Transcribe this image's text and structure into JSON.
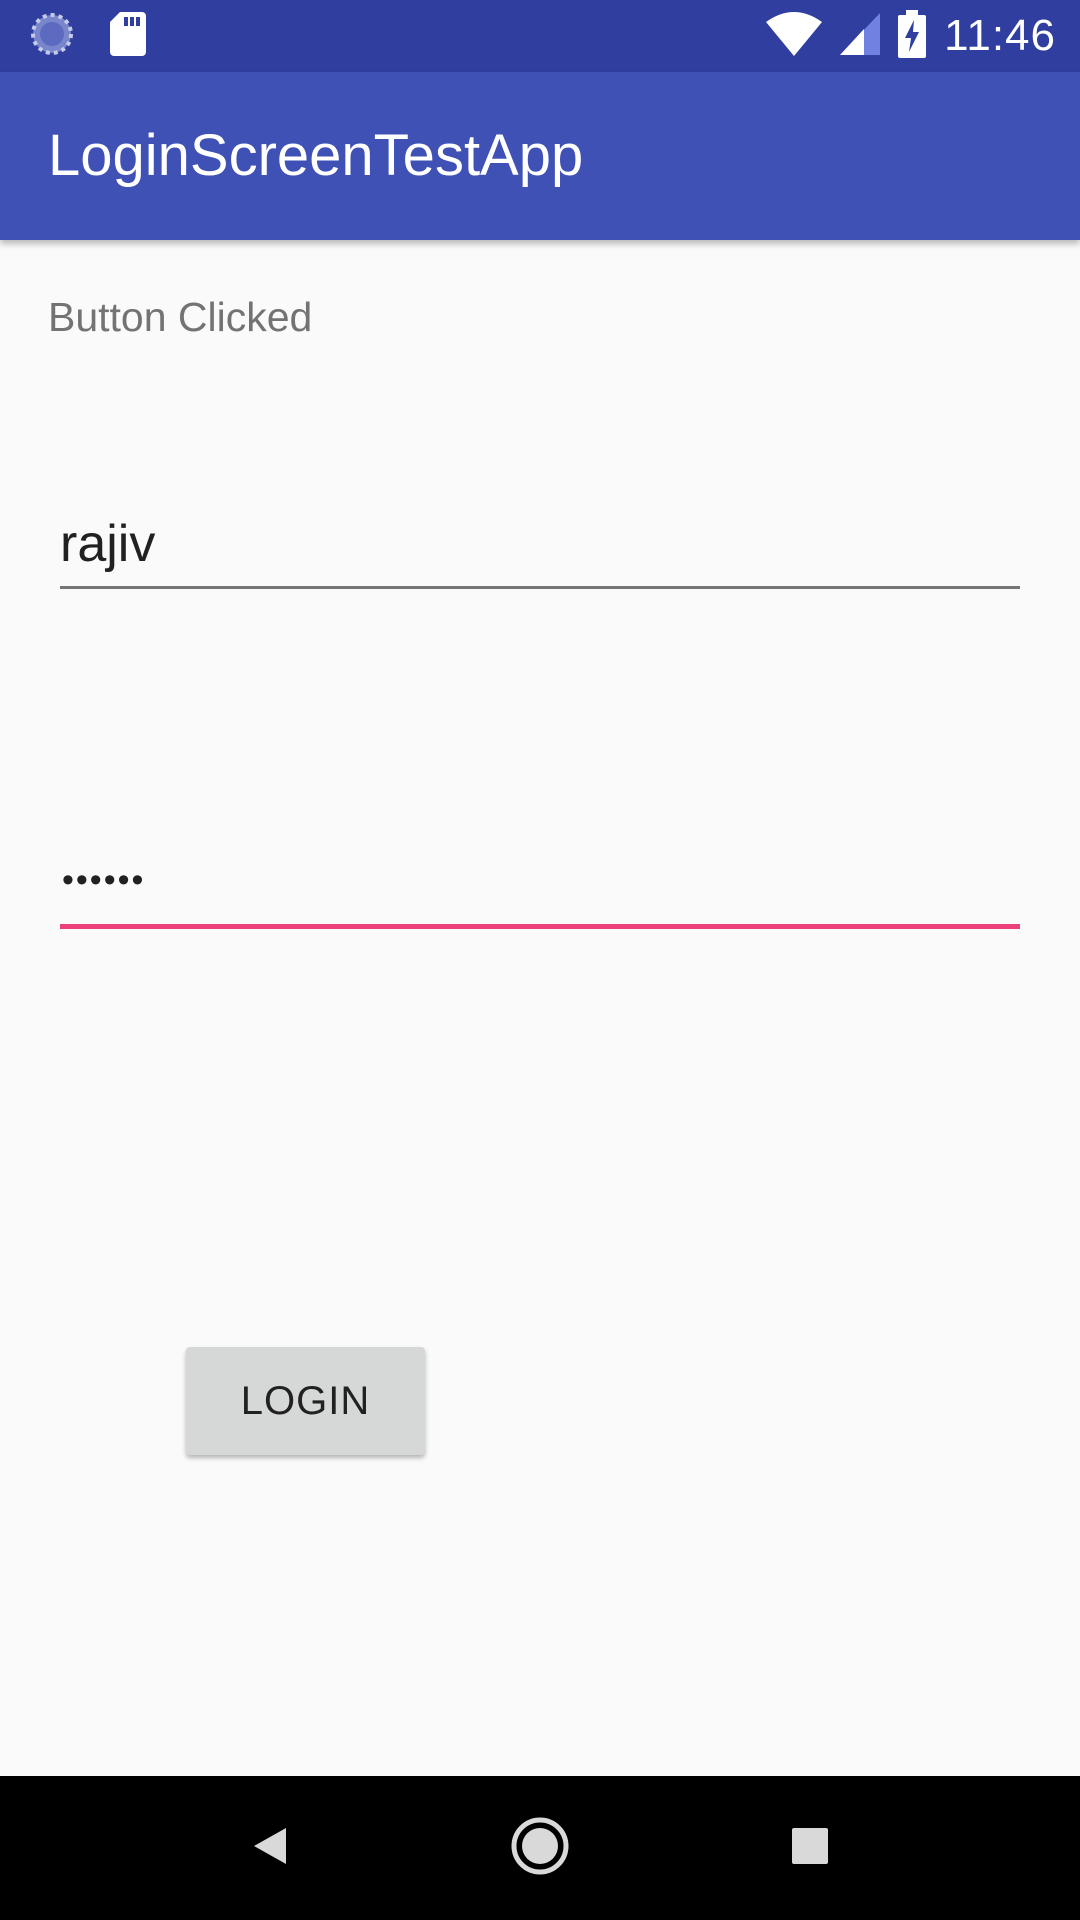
{
  "status_bar": {
    "time": "11:46",
    "icons": [
      "loading-spinner-icon",
      "sd-card-icon",
      "wifi-icon",
      "cellular-signal-icon",
      "battery-charging-icon"
    ]
  },
  "app_bar": {
    "title": "LoginScreenTestApp"
  },
  "main": {
    "status_message": "Button Clicked",
    "username_value": "rajiv",
    "password_mask": "••••••",
    "login_label": "LOGIN"
  },
  "nav_bar": {
    "icons": [
      "back-icon",
      "home-icon",
      "recents-icon"
    ]
  },
  "colors": {
    "status_bar": "#303f9f",
    "app_bar": "#3f51b5",
    "accent": "#ec407a",
    "background": "#fafafa",
    "button": "#d6d7d7"
  }
}
